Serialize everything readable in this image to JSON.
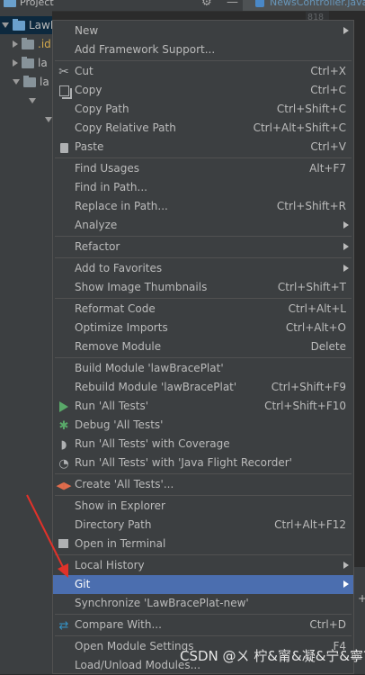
{
  "header": {
    "project_label": "Project",
    "editor_tab": "NewsController.java"
  },
  "tree": {
    "nodes": [
      "LawB",
      ".id",
      "la",
      "la"
    ]
  },
  "editor": {
    "line_number": "818"
  },
  "menu": {
    "items": [
      {
        "label": "New",
        "shortcut": "",
        "submenu": true
      },
      {
        "label": "Add Framework Support...",
        "shortcut": ""
      },
      {
        "label": "Cut",
        "shortcut": "Ctrl+X",
        "icon": "scissors-icon"
      },
      {
        "label": "Copy",
        "shortcut": "Ctrl+C",
        "icon": "copy-icon"
      },
      {
        "label": "Copy Path",
        "shortcut": "Ctrl+Shift+C"
      },
      {
        "label": "Copy Relative Path",
        "shortcut": "Ctrl+Alt+Shift+C"
      },
      {
        "label": "Paste",
        "shortcut": "Ctrl+V",
        "icon": "paste-icon"
      },
      {
        "label": "Find Usages",
        "shortcut": "Alt+F7"
      },
      {
        "label": "Find in Path...",
        "shortcut": ""
      },
      {
        "label": "Replace in Path...",
        "shortcut": "Ctrl+Shift+R"
      },
      {
        "label": "Analyze",
        "shortcut": "",
        "submenu": true
      },
      {
        "label": "Refactor",
        "shortcut": "",
        "submenu": true
      },
      {
        "label": "Add to Favorites",
        "shortcut": "",
        "submenu": true
      },
      {
        "label": "Show Image Thumbnails",
        "shortcut": "Ctrl+Shift+T"
      },
      {
        "label": "Reformat Code",
        "shortcut": "Ctrl+Alt+L"
      },
      {
        "label": "Optimize Imports",
        "shortcut": "Ctrl+Alt+O"
      },
      {
        "label": "Remove Module",
        "shortcut": "Delete"
      },
      {
        "label": "Build Module 'lawBracePlat'",
        "shortcut": ""
      },
      {
        "label": "Rebuild Module 'lawBracePlat'",
        "shortcut": "Ctrl+Shift+F9"
      },
      {
        "label": "Run 'All Tests'",
        "shortcut": "Ctrl+Shift+F10",
        "icon": "run-icon"
      },
      {
        "label": "Debug 'All Tests'",
        "shortcut": "",
        "icon": "debug-icon"
      },
      {
        "label": "Run 'All Tests' with Coverage",
        "shortcut": "",
        "icon": "coverage-icon"
      },
      {
        "label": "Run 'All Tests' with 'Java Flight Recorder'",
        "shortcut": "",
        "icon": "profiler-icon"
      },
      {
        "label": "Create 'All Tests'...",
        "shortcut": "",
        "icon": "create-config-icon"
      },
      {
        "label": "Show in Explorer",
        "shortcut": ""
      },
      {
        "label": "Directory Path",
        "shortcut": "Ctrl+Alt+F12"
      },
      {
        "label": "Open in Terminal",
        "shortcut": "",
        "icon": "terminal-icon"
      },
      {
        "label": "Local History",
        "shortcut": "",
        "submenu": true
      },
      {
        "label": "Git",
        "shortcut": "",
        "submenu": true,
        "highlighted": true
      },
      {
        "label": "Synchronize 'LawBracePlat-new'",
        "shortcut": ""
      },
      {
        "label": "Compare With...",
        "shortcut": "Ctrl+D",
        "icon": "compare-icon"
      },
      {
        "label": "Open Module Settings",
        "shortcut": "F4"
      },
      {
        "label": "Load/Unload Modules...",
        "shortcut": ""
      }
    ]
  },
  "watermark": "CSDN @ㄨ 柠&甯&凝&宁&寧？",
  "colors": {
    "menu_bg": "#3c3f41",
    "highlight": "#4b6eaf",
    "annotation": "#e0322a"
  }
}
